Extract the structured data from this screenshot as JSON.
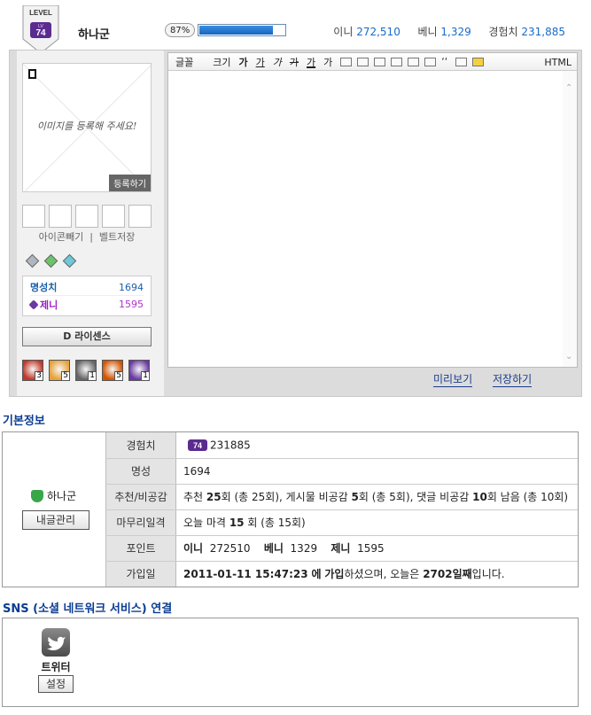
{
  "header": {
    "level_caption": "LEVEL",
    "level_small": "LV",
    "level": "74",
    "username": "하나군",
    "exp_percent_label": "87%",
    "exp_fraction": 0.87,
    "ini_label": "이니",
    "ini_value": "272,510",
    "beni_label": "베니",
    "beni_value": "1,329",
    "exp_label": "경험치",
    "exp_value": "231,885"
  },
  "profile": {
    "image_prompt": "이미지를 등록해 주세요!",
    "register_label": "등록하기",
    "icon_remove_label": "아이콘빼기",
    "divider": "|",
    "belt_save_label": "벨트저장",
    "fame_label": "명성치",
    "fame_value": "1694",
    "zeny_label": "제니",
    "zeny_value": "1595",
    "license_label": "D 라이센스",
    "items": [
      {
        "icon": "red-box-icon",
        "count": "3",
        "color": "#c0392b"
      },
      {
        "icon": "orange-flower-icon",
        "count": "5",
        "color": "#e6a23c"
      },
      {
        "icon": "gray-avatar-icon",
        "count": "1",
        "color": "#666666"
      },
      {
        "icon": "orange-flower-icon",
        "count": "5",
        "color": "#d35400"
      },
      {
        "icon": "purple-box-icon",
        "count": "1",
        "color": "#6a3aa0"
      }
    ]
  },
  "editor": {
    "font_label": "글꼴",
    "size_label": "크기",
    "bold_label": "가",
    "underline_label": "가",
    "italic_label": "가",
    "strike_label": "가",
    "color_label": "가",
    "bg_label": "가",
    "quote_label": "‘‘",
    "html_label": "HTML",
    "preview_label": "미리보기",
    "save_label": "저장하기"
  },
  "basic_info": {
    "title": "기본정보",
    "username": "하나군",
    "manage_label": "내글관리",
    "exp_label": "경험치",
    "exp_level": "74",
    "exp_value": "231885",
    "fame_label": "명성",
    "fame_value": "1694",
    "rec_label": "추천/비공감",
    "rec_a": "추천",
    "rec_n1": "25",
    "rec_b": "회 (총 25회), 게시물 비공감",
    "rec_n2": "5",
    "rec_c": "회 (총 5회), 댓글 비공감",
    "rec_n3": "10",
    "rec_d": "회 남음 (총 10회)",
    "attack_label": "마무리일격",
    "attack_a": "오늘 마격",
    "attack_n": "15",
    "attack_b": "회 (총 15회)",
    "points_label": "포인트",
    "pt_ini_label": "이니",
    "pt_ini": "272510",
    "pt_beni_label": "베니",
    "pt_beni": "1329",
    "pt_zeny_label": "제니",
    "pt_zeny": "1595",
    "join_label": "가입일",
    "join_date": "2011-01-11 15:47:23",
    "join_a": "에",
    "join_b": "가입",
    "join_c": "하셨으며, 오늘은",
    "join_days": "2702일째",
    "join_d": "입니다."
  },
  "sns": {
    "title": "SNS (소셜 네트워크 서비스) 연결",
    "twitter_label": "트위터",
    "setting_label": "설정"
  },
  "colors": {
    "accent_blue": "#1a6bc6",
    "title_blue": "#0b3d91",
    "zeny_purple": "#a020c0",
    "panel_gray": "#dcdcdc"
  }
}
